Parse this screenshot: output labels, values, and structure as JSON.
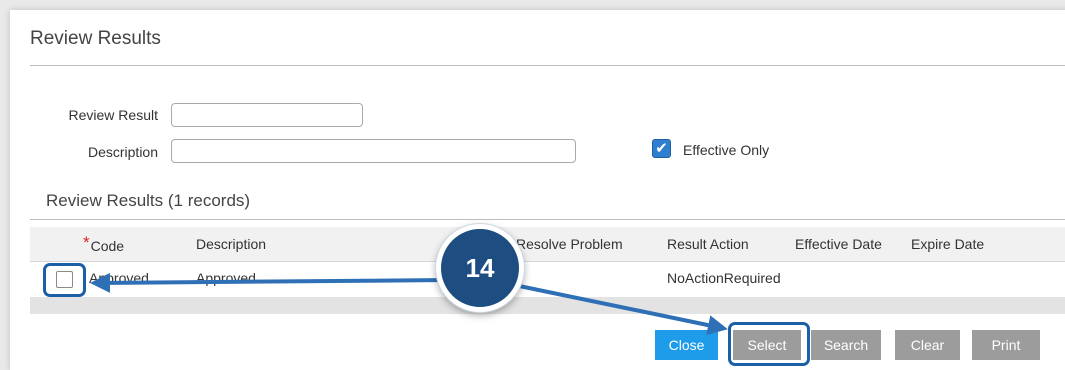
{
  "page": {
    "title": "Review Results"
  },
  "form": {
    "review_result_label": "Review Result",
    "review_result_value": "",
    "description_label": "Description",
    "description_value": "",
    "effective_only_label": "Effective Only",
    "effective_only_checked": true
  },
  "results": {
    "section_title": "Review Results (1 records)",
    "columns": [
      {
        "label": "Code",
        "required": true
      },
      {
        "label": "Description"
      },
      {
        "label": "Resolve Problem"
      },
      {
        "label": "Result Action"
      },
      {
        "label": "Effective Date"
      },
      {
        "label": "Expire Date"
      }
    ],
    "rows": [
      {
        "code": "Approved",
        "description": "Approved",
        "resolve_problem": "",
        "result_action": "NoActionRequired",
        "effective_date": "",
        "expire_date": ""
      }
    ]
  },
  "buttons": {
    "close": "Close",
    "select": "Select",
    "search": "Search",
    "clear": "Clear",
    "print": "Print"
  },
  "callout": {
    "step": "14",
    "color": "#1b5fa6"
  },
  "colors": {
    "primary_button": "#1e9be9",
    "secondary_button": "#9c9c9c",
    "required_marker": "#e02020"
  }
}
